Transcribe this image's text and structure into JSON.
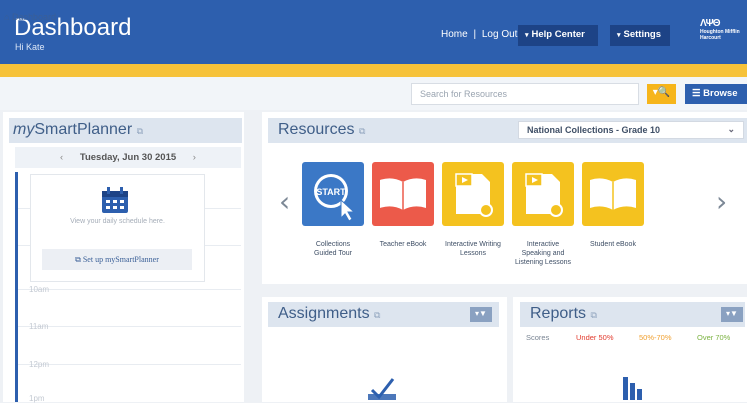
{
  "header": {
    "title": "Dashboard",
    "greeting": "Hi Kate",
    "home_link": "Home",
    "separator": "|",
    "logout_link": "Log Out",
    "help_center": "Help Center",
    "settings": "Settings",
    "logo_mark": "ΛΨΘ",
    "logo_name": "Houghton Mifflin Harcourt"
  },
  "breadcrumb": {
    "label": "Dashboard"
  },
  "search": {
    "placeholder": "Search for Resources"
  },
  "browse": {
    "label": "Browse"
  },
  "planner": {
    "title_prefix": "my",
    "title_suffix": "SmartPlanner",
    "date": "Tuesday, Jun 30 2015",
    "prev": "‹",
    "next": "›",
    "message": "View your daily schedule here.",
    "setup_label": "Set up mySmartPlanner",
    "times": [
      "10am",
      "11am",
      "12pm",
      "1pm"
    ]
  },
  "resources": {
    "title": "Resources",
    "collection": "National Collections - Grade 10",
    "items": [
      {
        "label_line1": "Collections",
        "label_line2": "Guided Tour",
        "label_line3": "",
        "color": "#3b78c6",
        "icon": "start-icon",
        "badge": "START"
      },
      {
        "label_line1": "Teacher eBook",
        "label_line2": "",
        "label_line3": "",
        "color": "#ec5a4a",
        "icon": "book-icon",
        "badge": ""
      },
      {
        "label_line1": "Interactive Writing",
        "label_line2": "Lessons",
        "label_line3": "",
        "color": "#f4c21f",
        "icon": "video-document-icon",
        "badge": ""
      },
      {
        "label_line1": "Interactive",
        "label_line2": "Speaking and",
        "label_line3": "Listening Lessons",
        "color": "#f4c21f",
        "icon": "video-document-icon",
        "badge": ""
      },
      {
        "label_line1": "Student eBook",
        "label_line2": "",
        "label_line3": "",
        "color": "#f4c21f",
        "icon": "book-icon",
        "badge": ""
      }
    ]
  },
  "assignments": {
    "title": "Assignments"
  },
  "reports": {
    "title": "Reports",
    "scores_label": "Scores",
    "under": "Under 50%",
    "mid": "50%-70%",
    "over": "Over 70%",
    "colors": {
      "under": "#e23b2e",
      "mid": "#f0a030",
      "over": "#7cb342"
    }
  }
}
